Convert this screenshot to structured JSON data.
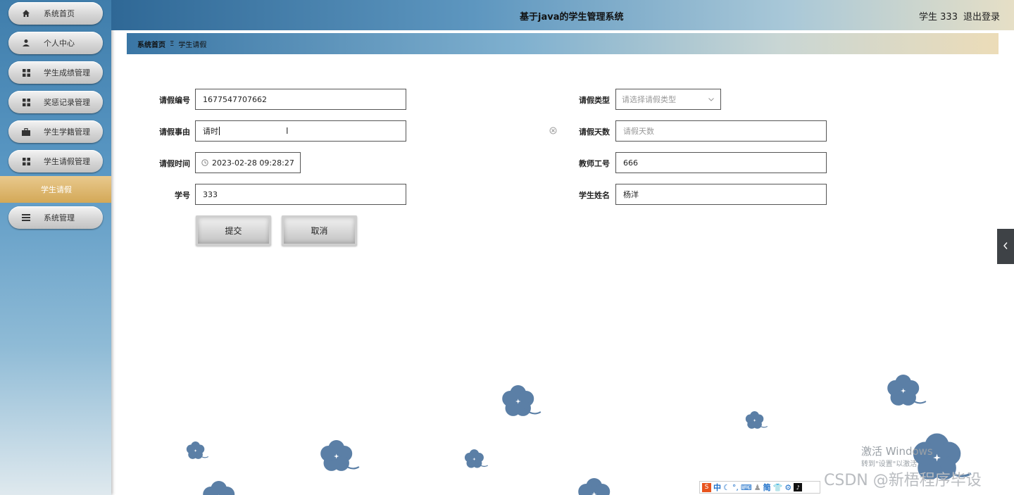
{
  "header": {
    "title": "基于java的学生管理系统",
    "user": "学生 333",
    "logout": "退出登录"
  },
  "sidebar": {
    "items": [
      {
        "label": "系统首页",
        "icon": "home-icon"
      },
      {
        "label": "个人中心",
        "icon": "user-icon"
      },
      {
        "label": "学生成绩管理",
        "icon": "grid-icon"
      },
      {
        "label": "奖惩记录管理",
        "icon": "grid-icon"
      },
      {
        "label": "学生学籍管理",
        "icon": "briefcase-icon"
      },
      {
        "label": "学生请假管理",
        "icon": "grid-icon"
      },
      {
        "label": "系统管理",
        "icon": "list-icon"
      }
    ],
    "active_sub": "学生请假"
  },
  "breadcrumb": {
    "home": "系统首页",
    "separator": "Ξ",
    "current": "学生请假"
  },
  "form": {
    "leave_no": {
      "label": "请假编号",
      "value": "1677547707662"
    },
    "leave_type": {
      "label": "请假类型",
      "placeholder": "请选择请假类型"
    },
    "reason": {
      "label": "请假事由",
      "value": "请时"
    },
    "days": {
      "label": "请假天数",
      "placeholder": "请假天数"
    },
    "time": {
      "label": "请假时间",
      "value": "2023-02-28 09:28:27"
    },
    "teacher_no": {
      "label": "教师工号",
      "value": "666"
    },
    "student_no": {
      "label": "学号",
      "value": "333"
    },
    "student_name": {
      "label": "学生姓名",
      "value": "杨洋"
    },
    "submit": "提交",
    "cancel": "取消"
  },
  "overlay": {
    "activate_title": "激活 Windows",
    "activate_sub": "转到\"设置\"以激活",
    "csdn": "CSDN @新梧程序毕设"
  },
  "taskbar": {
    "ime": "中",
    "simplified": "简"
  },
  "colors": {
    "sidebar_top": "#3f7dab",
    "active_gold": "#d3a857",
    "flower": "#5b7fa6"
  }
}
